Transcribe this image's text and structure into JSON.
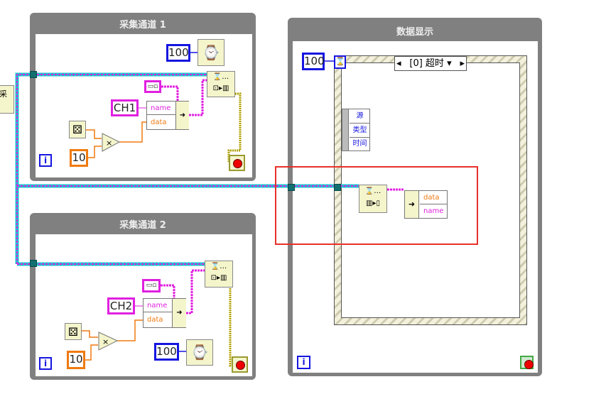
{
  "loops": [
    {
      "title": "采集通道 1",
      "wait_ms": "100",
      "channel": "CH1",
      "multiplier": "10",
      "fields": [
        "name",
        "data"
      ],
      "iteration": "i"
    },
    {
      "title": "采集通道 2",
      "wait_ms": "100",
      "channel": "CH2",
      "multiplier": "10",
      "fields": [
        "name",
        "data"
      ],
      "iteration": "i"
    }
  ],
  "display": {
    "title": "数据显示",
    "timeout": "100",
    "case_selector": "[0] 超时",
    "event_fields": [
      "源",
      "类型",
      "时间"
    ],
    "unbundle_fields": [
      "data",
      "name"
    ],
    "iteration": "i"
  },
  "left_node": "采",
  "colors": {
    "string_wire": "#e020e0",
    "numeric_wire": "#f07a10",
    "int_wire": "#1515e0",
    "bool_wire": "#b0a000",
    "highlight": "#e8302a"
  }
}
